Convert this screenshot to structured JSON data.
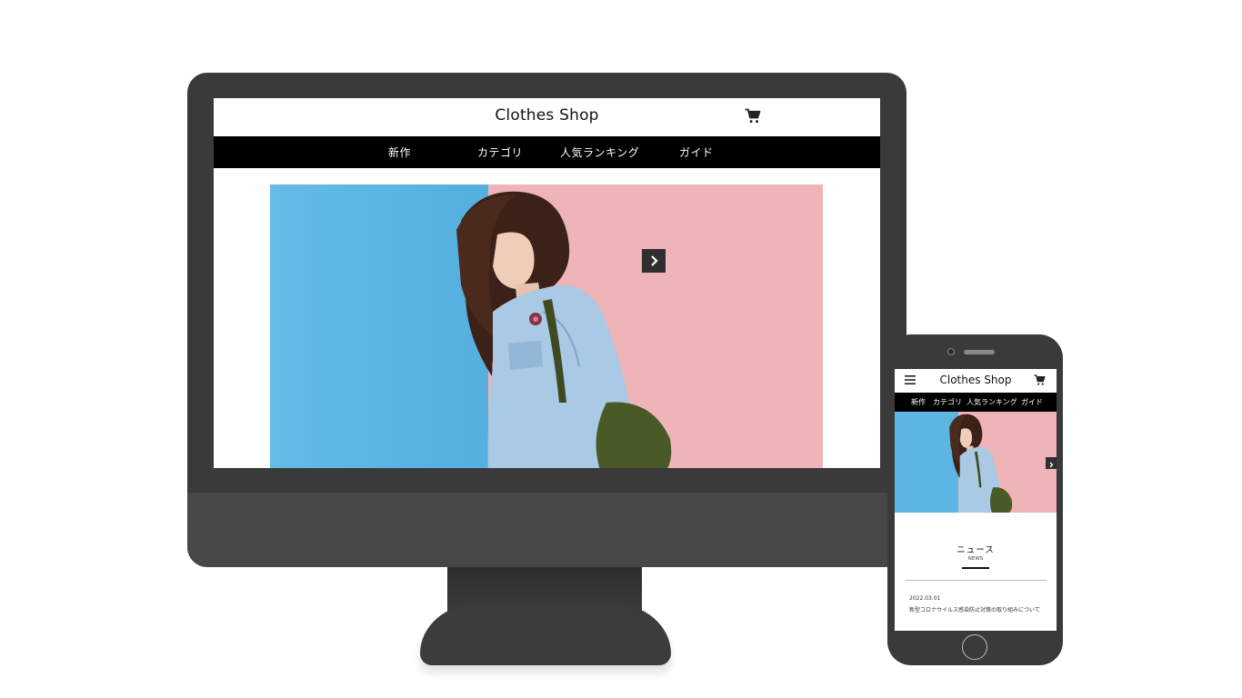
{
  "desktop": {
    "logo": "Clothes Shop",
    "nav": {
      "new": "新作",
      "category": "カテゴリ",
      "ranking": "人気ランキング",
      "guide": "ガイド"
    },
    "cart_icon": "cart-icon",
    "next_icon": "chevron-right-icon"
  },
  "phone": {
    "logo": "Clothes Shop",
    "menu_icon": "hamburger-menu-icon",
    "cart_icon": "cart-icon",
    "nav": {
      "new": "新作",
      "category": "カテゴリ",
      "ranking": "人気ランキング",
      "guide": "ガイド"
    },
    "news": {
      "title": "ニュース",
      "subtitle": "NEWS",
      "items": [
        {
          "date": "2022.03.01",
          "text": "新型コロナウイルス感染防止対策の取り組みについて"
        }
      ]
    }
  },
  "colors": {
    "device_body": "#3a3a3a",
    "nav_bar": "#000000",
    "hero_blue": "#5fb6e2",
    "hero_pink": "#efb4b8"
  }
}
